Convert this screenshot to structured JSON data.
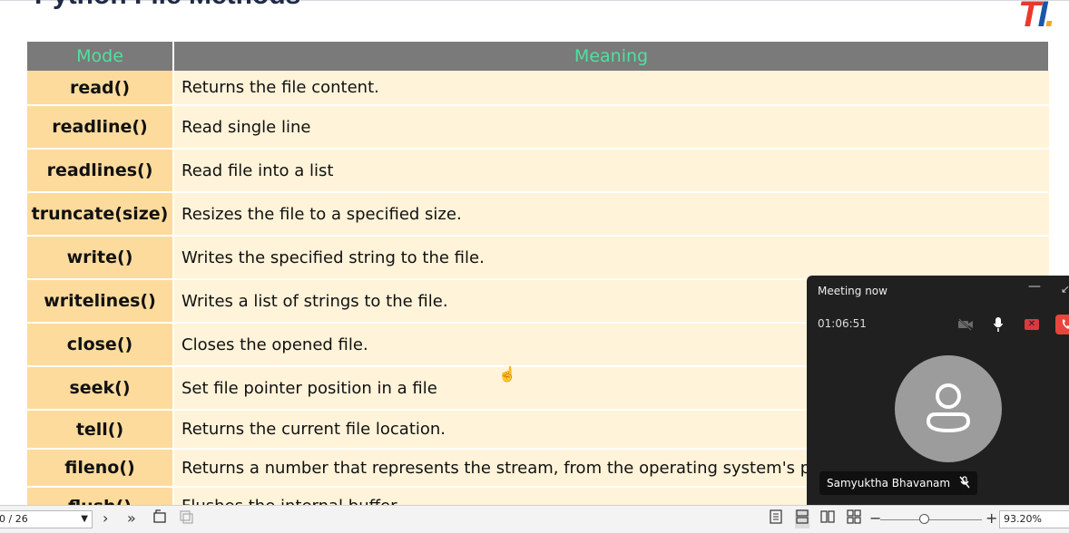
{
  "slide": {
    "title": "Python File Methods",
    "logo": {
      "a": "T",
      "b": "I",
      "c": "."
    },
    "table": {
      "headers": [
        "Mode",
        "Meaning"
      ],
      "rows": [
        {
          "mode": "read()",
          "meaning": "Returns the file content."
        },
        {
          "mode": "readline()",
          "meaning": "Read single line"
        },
        {
          "mode": "readlines()",
          "meaning": "Read file into a list"
        },
        {
          "mode": "truncate(size)",
          "meaning": "Resizes the file to a specified size."
        },
        {
          "mode": "write()",
          "meaning": "Writes the specified string to the file."
        },
        {
          "mode": "writelines()",
          "meaning": "Writes a list of strings to the file."
        },
        {
          "mode": "close()",
          "meaning": "Closes the opened file."
        },
        {
          "mode": "seek()",
          "meaning": "Set file pointer position in a file"
        },
        {
          "mode": "tell()",
          "meaning": "Returns the current file location."
        },
        {
          "mode": "fileno()",
          "meaning": "Returns a number that represents the stream, from the operating system's per"
        },
        {
          "mode": "flush()",
          "meaning": "Flushes the internal buffer"
        }
      ]
    }
  },
  "meeting": {
    "title": "Meeting now",
    "timer": "01:06:51",
    "participant": "Samyuktha Bhavanam",
    "minimize_glyph": "—",
    "expand_glyph": "↙"
  },
  "toolbar": {
    "page_indicator": "0 / 26",
    "zoom": "93.20%",
    "zoom_fraction": 0.43
  },
  "icons": [
    "next-page-icon",
    "last-page-icon",
    "rotate-icon",
    "copy-icon",
    "single-page-view-icon",
    "continuous-view-icon",
    "two-page-view-icon",
    "two-page-continuous-icon",
    "zoom-out-icon",
    "zoom-in-icon",
    "camera-off-icon",
    "mic-icon",
    "share-stop-icon",
    "hang-up-icon",
    "mic-muted-icon",
    "pan-hand-cursor-icon"
  ],
  "colors": {
    "header_bg": "#7a7a7a",
    "header_text": "#4fe0a2",
    "mode_bg": "#fddb9c",
    "meaning_bg": "#fff3d9",
    "meeting_bg": "#202020",
    "hangup": "#e8453c"
  }
}
